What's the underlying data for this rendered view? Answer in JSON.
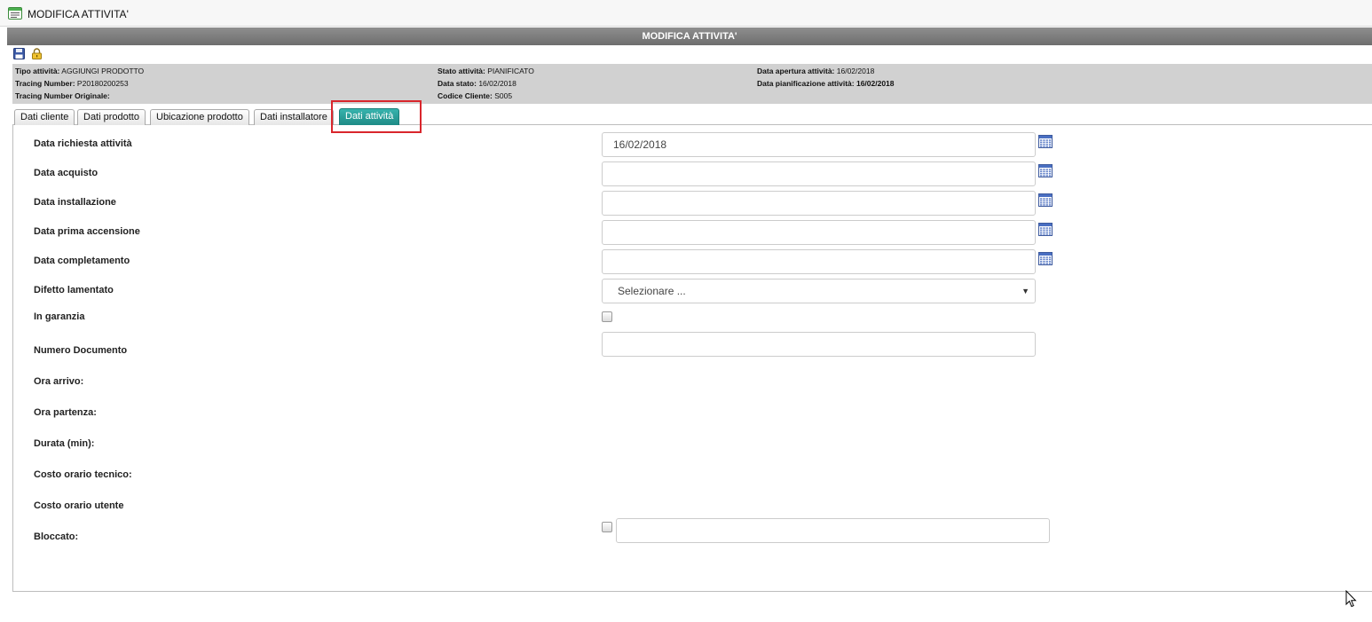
{
  "window": {
    "title": "MODIFICA ATTIVITA'",
    "icon": "form-icon"
  },
  "header": {
    "title": "MODIFICA ATTIVITA'"
  },
  "toolbar": {
    "save_icon": "floppy-disk-icon",
    "lock_icon": "lock-icon"
  },
  "info": {
    "tipo_attivita_label": "Tipo attività:",
    "tipo_attivita_value": "AGGIUNGI PRODOTTO",
    "tracing_number_label": "Tracing Number:",
    "tracing_number_value": "P20180200253",
    "tracing_number_orig_label": "Tracing Number Originale:",
    "tracing_number_orig_value": "",
    "stato_attivita_label": "Stato attività:",
    "stato_attivita_value": "PIANIFICATO",
    "data_stato_label": "Data stato:",
    "data_stato_value": "16/02/2018",
    "codice_cliente_label": "Codice Cliente:",
    "codice_cliente_value": "S005",
    "data_apertura_label": "Data apertura attività:",
    "data_apertura_value": "16/02/2018",
    "data_pianificazione_label": "Data pianificazione attività:",
    "data_pianificazione_value": "16/02/2018"
  },
  "tabs": [
    {
      "label": "Dati cliente",
      "active": false
    },
    {
      "label": "Dati prodotto",
      "active": false
    },
    {
      "label": "Ubicazione prodotto",
      "active": false
    },
    {
      "label": "Dati installatore",
      "active": false
    },
    {
      "label": "Dati attività",
      "active": true
    }
  ],
  "form": {
    "data_richiesta": {
      "label": "Data richiesta attività",
      "value": "16/02/2018"
    },
    "data_acquisto": {
      "label": "Data acquisto",
      "value": ""
    },
    "data_installazione": {
      "label": "Data installazione",
      "value": ""
    },
    "data_prima_accensione": {
      "label": "Data prima accensione",
      "value": ""
    },
    "data_completamento": {
      "label": "Data completamento",
      "value": ""
    },
    "difetto_lamentato": {
      "label": "Difetto lamentato",
      "selected": "Selezionare ..."
    },
    "in_garanzia": {
      "label": "In garanzia",
      "checked": false
    },
    "numero_documento": {
      "label": "Numero Documento",
      "value": ""
    },
    "ora_arrivo": {
      "label": "Ora arrivo:"
    },
    "ora_partenza": {
      "label": "Ora partenza:"
    },
    "durata": {
      "label": "Durata (min):"
    },
    "costo_orario_tecnico": {
      "label": "Costo orario tecnico:"
    },
    "costo_orario_utente": {
      "label": "Costo orario utente"
    },
    "bloccato": {
      "label": "Bloccato:",
      "checked": false,
      "value": ""
    }
  },
  "colors": {
    "header_bar": "#7d7d7d",
    "info_panel": "#d1d1d1",
    "active_tab": "#2a9e98",
    "highlight_box": "#d9262c"
  }
}
